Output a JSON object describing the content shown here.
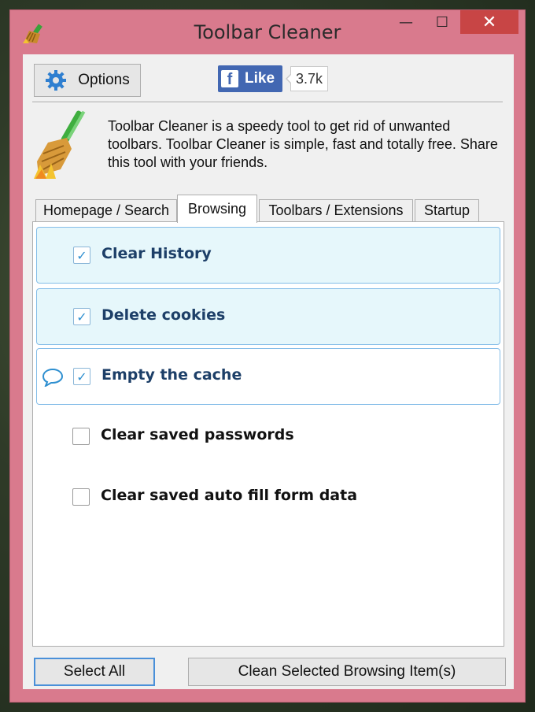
{
  "window": {
    "title": "Toolbar Cleaner",
    "controls": {
      "minimize": "—",
      "maximize": "☐",
      "close": "✕"
    }
  },
  "toolbar": {
    "options_label": "Options",
    "like_label": "Like",
    "like_count": "3.7k"
  },
  "description": "Toolbar Cleaner is a speedy tool to get rid of unwanted toolbars. Toolbar Cleaner is simple, fast and totally free. Share this tool with your friends.",
  "tabs": [
    {
      "label": "Homepage / Search",
      "active": false
    },
    {
      "label": "Browsing",
      "active": true
    },
    {
      "label": "Toolbars / Extensions",
      "active": false
    },
    {
      "label": "Startup",
      "active": false
    }
  ],
  "browsing_items": [
    {
      "label": "Clear History",
      "checked": true,
      "check_glyph": "✓"
    },
    {
      "label": "Delete cookies",
      "checked": true,
      "check_glyph": "✓"
    },
    {
      "label": "Empty the cache",
      "checked": true,
      "check_glyph": "✓"
    },
    {
      "label": "Clear saved passwords",
      "checked": false,
      "check_glyph": ""
    },
    {
      "label": "Clear saved auto fill form data",
      "checked": false,
      "check_glyph": ""
    }
  ],
  "footer": {
    "select_all_label": "Select All",
    "clean_label": "Clean Selected Browsing Item(s)"
  },
  "colors": {
    "window_frame": "#d97a8d",
    "close_button": "#c84545",
    "facebook_blue": "#4267b2",
    "highlight_bg": "#e6f7fb",
    "highlight_border": "#84bde8"
  }
}
